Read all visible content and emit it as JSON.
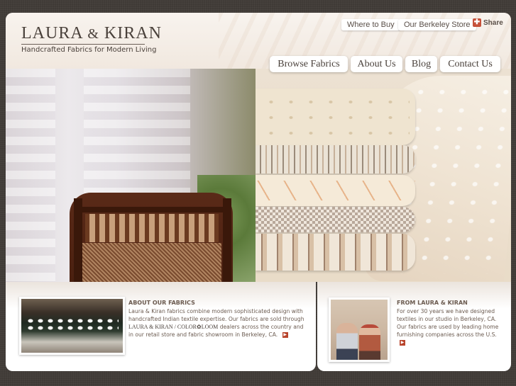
{
  "header": {
    "logo_part1": "LAURA",
    "logo_amp": "&",
    "logo_part2": "KIRAN",
    "tagline": "Handcrafted Fabrics for Modern Living"
  },
  "utility_nav": {
    "where_to_buy": "Where to Buy",
    "berkeley_store": "Our Berkeley Store",
    "share": "Share"
  },
  "main_nav": [
    {
      "label": "Browse Fabrics"
    },
    {
      "label": "About Us"
    },
    {
      "label": "Blog"
    },
    {
      "label": "Contact Us"
    }
  ],
  "about": {
    "title": "ABOUT OUR FABRICS",
    "text_before_logo": "Laura & Kiran fabrics combine modern sophisticated design with handcrafted Indian textile expertise. Our fabrics are sold through",
    "inline_logo": "LAURA & KIRAN / COLOR✿LOOM",
    "text_after_logo": "dealers across the country and in our retail store and fabric showroom in Berkeley, CA."
  },
  "founders": {
    "title": "FROM LAURA & KIRAN",
    "text": "For over 30 years we have designed textiles in our studio in Berkeley, CA. Our fabrics are used by leading home furnishing companies across the U.S."
  },
  "colors": {
    "background": "#3f3a36",
    "text": "#6b5b50",
    "accent": "#b8442c"
  }
}
